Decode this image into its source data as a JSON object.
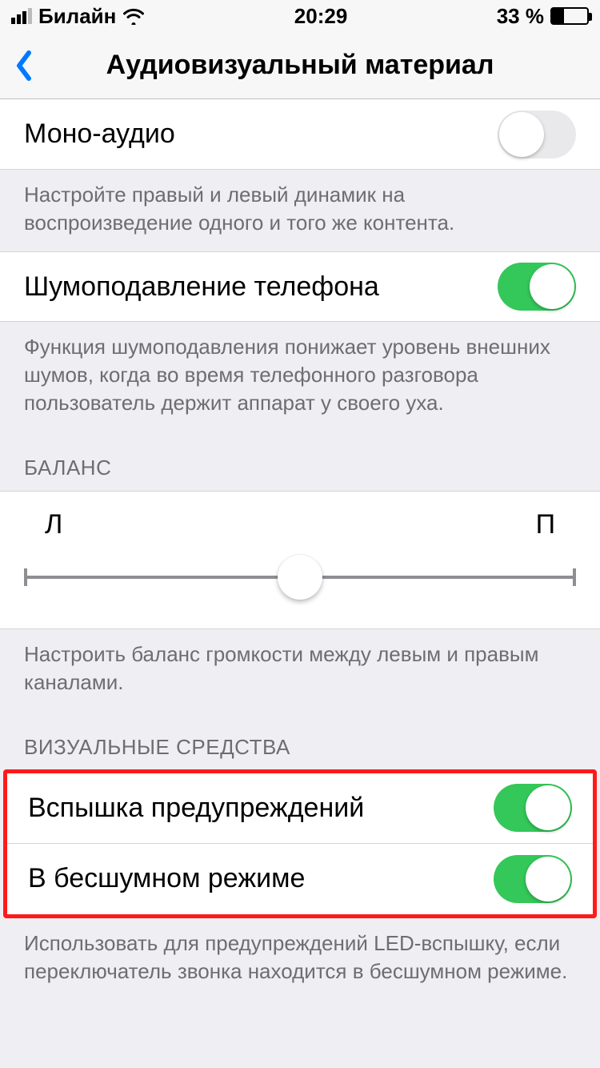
{
  "status": {
    "carrier": "Билайн",
    "time": "20:29",
    "battery_text": "33 %"
  },
  "nav": {
    "title": "Аудиовизуальный материал"
  },
  "mono": {
    "label": "Моно-аудио",
    "on": false,
    "footer": "Настройте правый и левый динамик на воспроизведение одного и того же контента."
  },
  "noise": {
    "label": "Шумоподавление телефона",
    "on": true,
    "footer": "Функция шумоподавления понижает уровень внешних шумов, когда во время телефонного разговора пользователь держит аппарат у своего уха."
  },
  "balance": {
    "header": "БАЛАНС",
    "left_label": "Л",
    "right_label": "П",
    "value": 50,
    "footer": "Настроить баланс громкости между левым и правым каналами."
  },
  "visual": {
    "header": "ВИЗУАЛЬНЫЕ СРЕДСТВА",
    "flash": {
      "label": "Вспышка предупреждений",
      "on": true
    },
    "silent": {
      "label": "В бесшумном режиме",
      "on": true
    },
    "footer": "Использовать для предупреждений LED-вспышку, если переключатель звонка находится в бесшумном режиме."
  }
}
